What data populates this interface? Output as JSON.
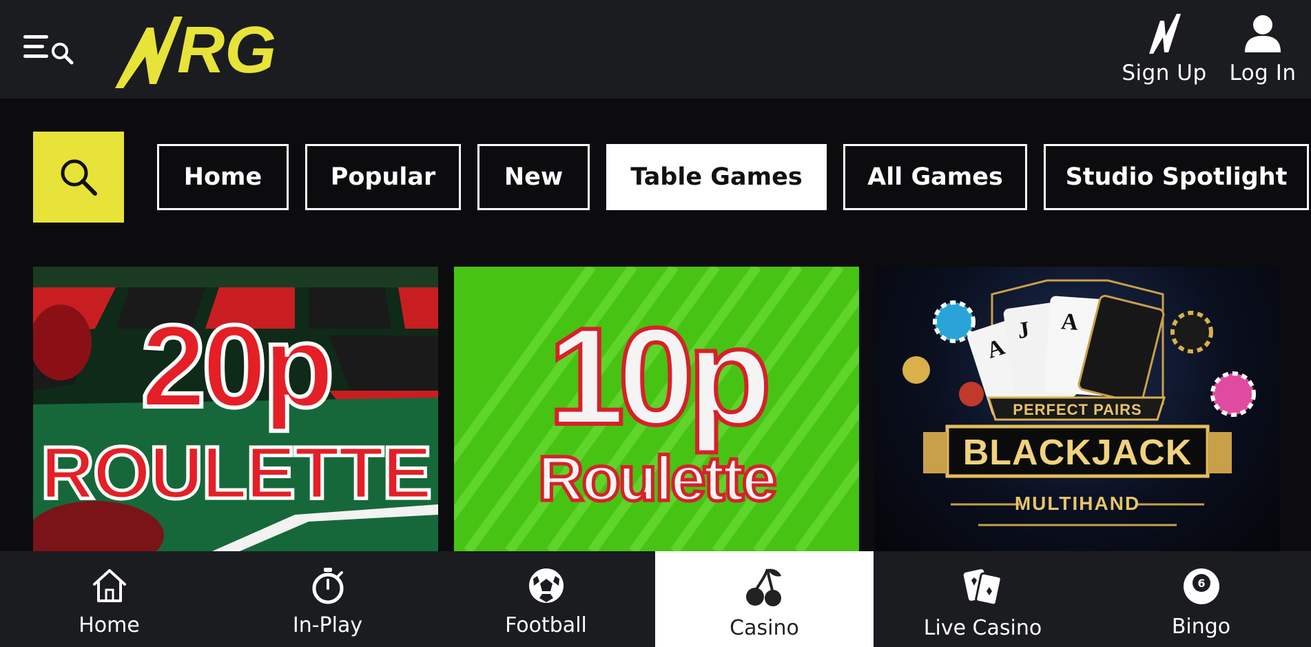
{
  "header": {
    "logo_text": "NRG",
    "brand_color": "#e7e339",
    "menu_icon": "menu-search-icon",
    "actions": [
      {
        "label": "Sign Up",
        "icon": "nrg-bolt-icon"
      },
      {
        "label": "Log In",
        "icon": "user-icon"
      }
    ]
  },
  "tabs": {
    "search_icon": "search-icon",
    "items": [
      {
        "label": "Home"
      },
      {
        "label": "Popular"
      },
      {
        "label": "New"
      },
      {
        "label": "Table Games",
        "active": true
      },
      {
        "label": "All Games"
      },
      {
        "label": "Studio Spotlight"
      }
    ]
  },
  "games": [
    {
      "line1": "20p",
      "line2": "ROULETTE"
    },
    {
      "line1": "10p",
      "line2": "Roulette",
      "pattern_text": "10p Roulette"
    },
    {
      "line1": "PERFECT PAIRS",
      "line2": "BLACKJACK",
      "line3": "MULTIHAND",
      "card_text": "BLACKJACK"
    }
  ],
  "bottom_nav": {
    "items": [
      {
        "label": "Home",
        "icon": "home-icon"
      },
      {
        "label": "In-Play",
        "icon": "stopwatch-icon"
      },
      {
        "label": "Football",
        "icon": "football-icon"
      },
      {
        "label": "Casino",
        "icon": "cherries-icon",
        "active": true
      },
      {
        "label": "Live Casino",
        "icon": "playing-cards-icon"
      },
      {
        "label": "Bingo",
        "icon": "bingo-ball-icon"
      }
    ]
  }
}
